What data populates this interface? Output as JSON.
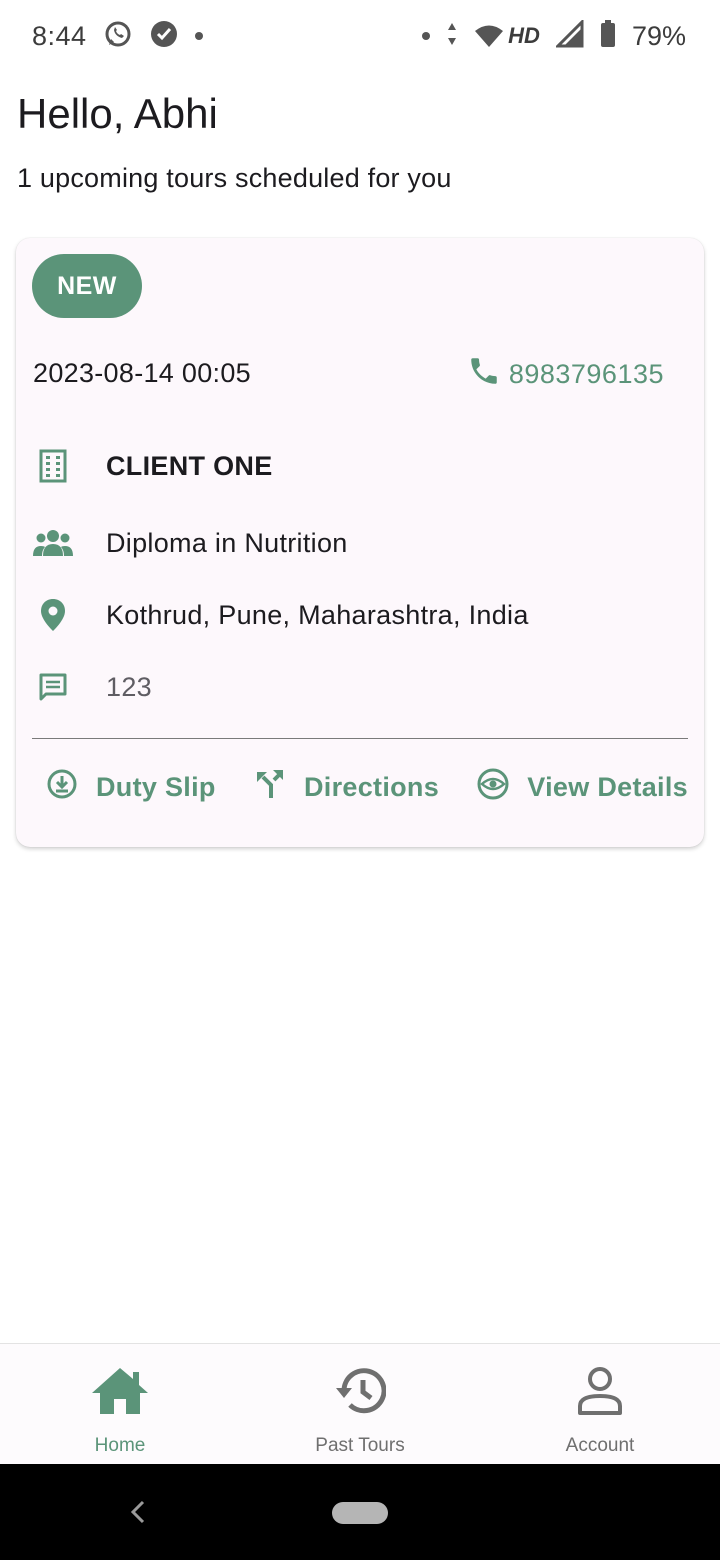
{
  "status_bar": {
    "time": "8:44",
    "network": "HD",
    "battery": "79%"
  },
  "header": {
    "greeting": "Hello, Abhi",
    "subtitle": "1 upcoming tours scheduled for you"
  },
  "tour_card": {
    "badge": "NEW",
    "datetime": "2023-08-14 00:05",
    "phone": "8983796135",
    "client": "CLIENT ONE",
    "course": "Diploma in Nutrition",
    "location": "Kothrud, Pune, Maharashtra, India",
    "notes": "123",
    "actions": {
      "duty_slip": "Duty Slip",
      "directions": "Directions",
      "view_details": "View Details"
    }
  },
  "bottom_nav": {
    "home": "Home",
    "past_tours": "Past Tours",
    "account": "Account",
    "active": "Home"
  },
  "colors": {
    "accent": "#5b9479",
    "card_background": "#fdf8fc",
    "inactive_nav": "#6f6f6f"
  },
  "icons": {
    "phone": "phone-icon",
    "client": "building-icon",
    "course": "group-icon",
    "location": "location-pin-icon",
    "notes": "comment-icon",
    "duty_slip": "download-circle-icon",
    "directions": "fork-directions-icon",
    "view_details": "eye-icon",
    "home": "home-icon",
    "past_tours": "history-icon",
    "account": "person-icon"
  }
}
